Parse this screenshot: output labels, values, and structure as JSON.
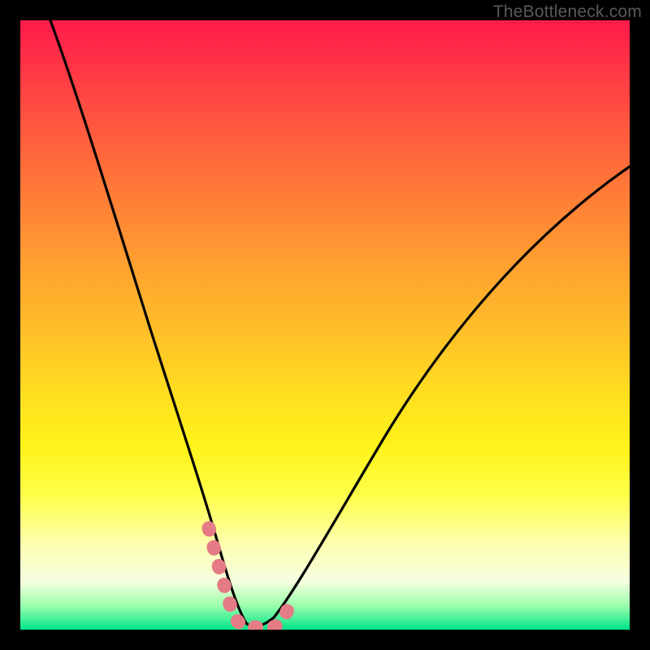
{
  "watermark": "TheBottleneck.com",
  "chart_data": {
    "type": "line",
    "title": "",
    "xlabel": "",
    "ylabel": "",
    "xlim": [
      0,
      100
    ],
    "ylim": [
      0,
      100
    ],
    "series": [
      {
        "name": "bottleneck-curve",
        "x": [
          5,
          8,
          12,
          16,
          20,
          24,
          27,
          30,
          32,
          34,
          36,
          40,
          44,
          48,
          54,
          62,
          72,
          84,
          100
        ],
        "y": [
          100,
          88,
          74,
          60,
          46,
          33,
          23,
          14,
          8,
          3,
          0,
          0,
          5,
          12,
          22,
          34,
          48,
          62,
          76
        ]
      }
    ],
    "highlight_segment": {
      "name": "optimal-range",
      "x": [
        30,
        32,
        34,
        36,
        40,
        42
      ],
      "y": [
        13,
        6,
        2,
        0,
        0,
        3
      ]
    },
    "gradient_stops": [
      {
        "pos": 0,
        "color": "#ff1a4b"
      },
      {
        "pos": 60,
        "color": "#ffe020"
      },
      {
        "pos": 100,
        "color": "#00e58a"
      }
    ]
  }
}
